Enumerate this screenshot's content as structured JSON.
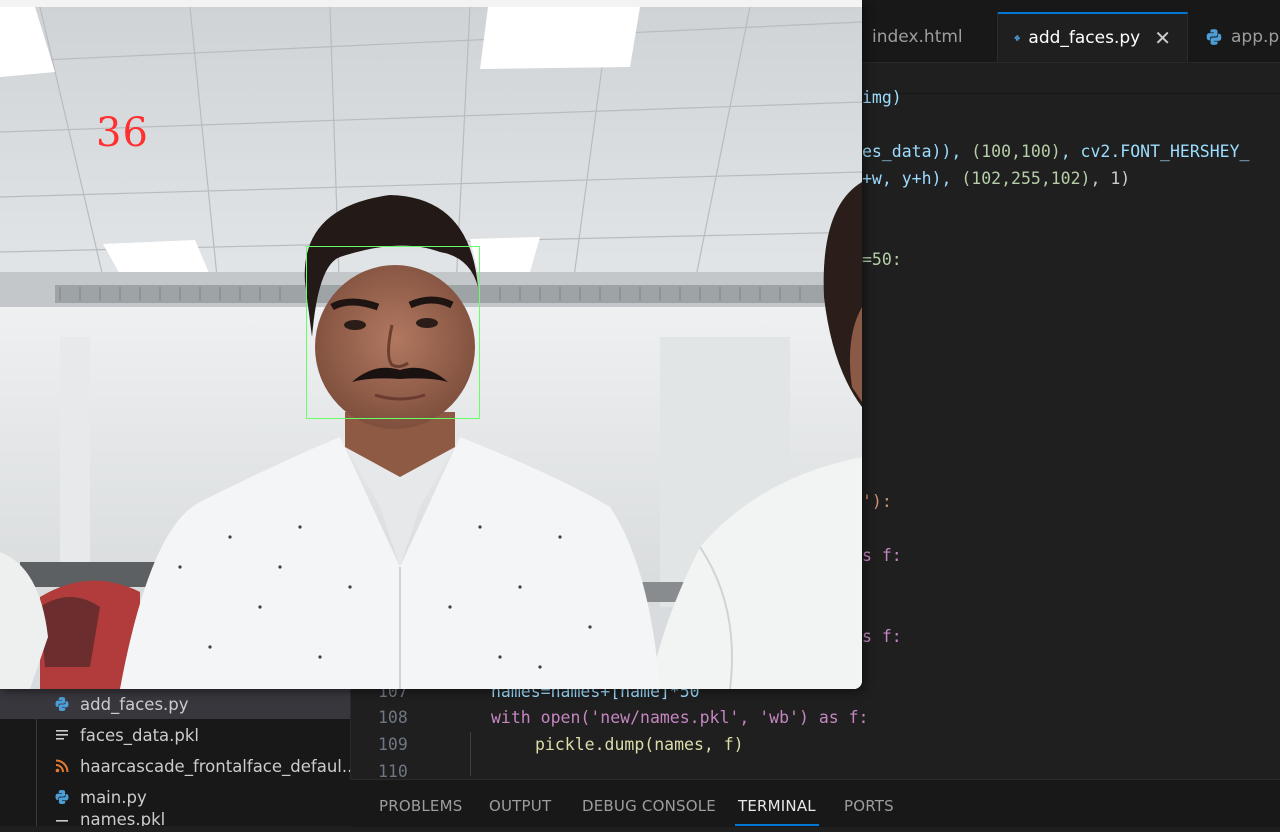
{
  "editor": {
    "tabs": [
      {
        "label": "index.html",
        "icon": "html-file-icon",
        "active": false
      },
      {
        "label": "add_faces.py",
        "icon": "python-file-icon",
        "active": true
      },
      {
        "label": "app.p",
        "icon": "python-file-icon",
        "active": false
      }
    ],
    "code_fragments": {
      "l1": "img)",
      "l2a": "es_data)), ",
      "l2b": "(100,100)",
      "l2c": ", cv2.FONT_HERSHEY_",
      "l3a": "+w, y+h), ",
      "l3b": "(102,255,102)",
      "l3c": ", 1)",
      "l4": "=50:",
      "l5": "'):",
      "l6": "s f:",
      "l7": "s f:"
    },
    "lines": [
      {
        "number": "107",
        "text": "names=names+[name]*50"
      },
      {
        "number": "108",
        "text": "with open('new/names.pkl', 'wb') as f:"
      },
      {
        "number": "109",
        "text": "pickle.dump(names, f)"
      },
      {
        "number": "110",
        "text": ""
      }
    ]
  },
  "explorer": {
    "files": [
      {
        "name": "add_faces.py",
        "icon": "python-file-icon",
        "selected": true
      },
      {
        "name": "faces_data.pkl",
        "icon": "text-file-icon",
        "selected": false
      },
      {
        "name": "haarcascade_frontalface_defaul...",
        "icon": "rss-xml-file-icon",
        "selected": false
      },
      {
        "name": "main.py",
        "icon": "python-file-icon",
        "selected": false
      },
      {
        "name": "names.pkl",
        "icon": "text-file-icon",
        "selected": false
      }
    ]
  },
  "panel": {
    "tabs": [
      "PROBLEMS",
      "OUTPUT",
      "DEBUG CONSOLE",
      "TERMINAL",
      "PORTS"
    ],
    "active": "TERMINAL"
  },
  "camera": {
    "counter": "36",
    "box_color": "#66ff66",
    "counter_color": "#ff3030"
  },
  "colors": {
    "accent": "#0078d4",
    "editor_bg": "#1f1f1f",
    "sidebar_bg": "#181818"
  }
}
